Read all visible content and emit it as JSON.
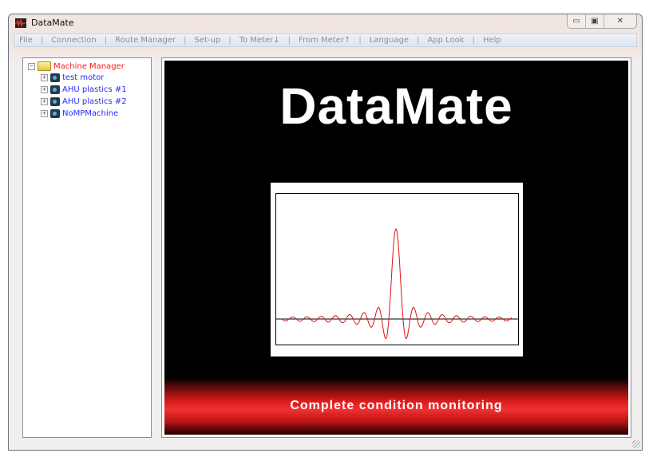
{
  "window": {
    "title": "DataMate",
    "controls": [
      "minimize",
      "maximize",
      "close"
    ]
  },
  "menu": [
    "File",
    "Connection",
    "Route Manager",
    "Set-up",
    "To Meter↓",
    "From Meter↑",
    "Language",
    "App Look",
    "Help"
  ],
  "tree": {
    "root": "Machine Manager",
    "items": [
      "test motor",
      "AHU plastics #1",
      "AHU plastics #2",
      "NoMPMachine"
    ]
  },
  "splash": {
    "title": "DataMate",
    "tagline": "Complete condition monitoring"
  },
  "colors": {
    "root": "#ff1a1a",
    "item": "#2a2aff",
    "wave": "#e01010"
  }
}
